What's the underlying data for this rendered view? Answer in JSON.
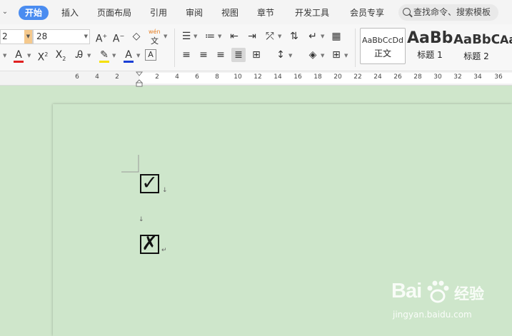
{
  "menu": {
    "tabs": [
      {
        "label": "开始",
        "active": true
      },
      {
        "label": "插入"
      },
      {
        "label": "页面布局"
      },
      {
        "label": "引用"
      },
      {
        "label": "审阅"
      },
      {
        "label": "视图"
      },
      {
        "label": "章节"
      },
      {
        "label": "开发工具"
      },
      {
        "label": "会员专享"
      }
    ],
    "search_label": "查找命令、搜索模板"
  },
  "toolbar": {
    "font_name": "2",
    "font_size": "28",
    "wen_pinyin": "wén",
    "wen_char": "文",
    "styles": [
      {
        "sample": "AaBbCcDd",
        "name": "正文"
      },
      {
        "sample": "AaBb",
        "name": "标题 1"
      },
      {
        "sample": "AaBbC",
        "name": "标题 2"
      },
      {
        "sample": "Aa",
        "name": ""
      }
    ],
    "accent_color": "#4a8cf0",
    "font_color": "#1a3fd6",
    "highlight_color": "#f5e000",
    "text_effect_color": "#e02020"
  },
  "ruler": {
    "ticks": [
      "6",
      "4",
      "2",
      "2",
      "4",
      "6",
      "8",
      "10",
      "12",
      "14",
      "16",
      "18",
      "20",
      "22",
      "24",
      "26",
      "28",
      "30",
      "32",
      "34",
      "36"
    ]
  },
  "document": {
    "check_symbol": "✓",
    "cross_symbol": "✗",
    "para_mark": "↵",
    "line_mark": "↓"
  },
  "watermark": {
    "brand_text": "Bai",
    "brand_suffix": "经验",
    "url": "jingyan.baidu.com"
  }
}
